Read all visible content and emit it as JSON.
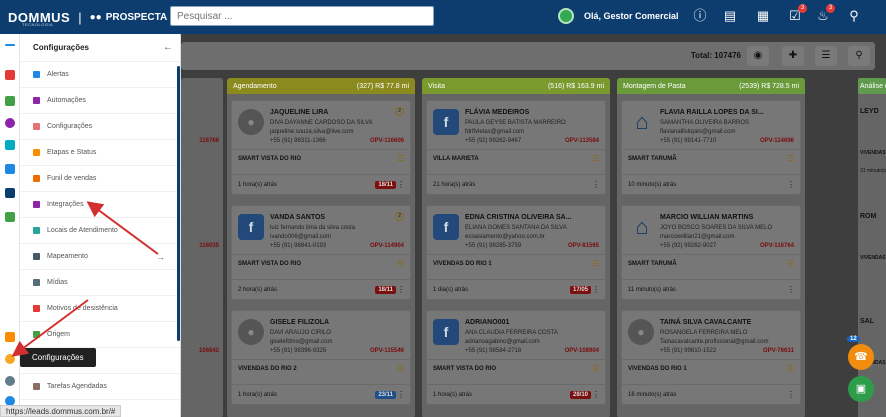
{
  "app": {
    "logo_main": "DOMMUS",
    "logo_sub": "TECNOLOGIA",
    "module": "PROSPECTA",
    "search_placeholder": "Pesquisar ...",
    "greeting": "Olá, Gestor Comercial",
    "badges": {
      "tasks": "3",
      "notifications": "3"
    }
  },
  "menu": {
    "title": "Configurações",
    "items": [
      {
        "label": "Alertas",
        "color": "#1e88e5"
      },
      {
        "label": "Automações",
        "color": "#8e24aa"
      },
      {
        "label": "Configurações",
        "color": "#e57373"
      },
      {
        "label": "Etapas e Status",
        "color": "#fb8c00"
      },
      {
        "label": "Funil de vendas",
        "color": "#ef6c00"
      },
      {
        "label": "Integrações",
        "color": "#8e24aa"
      },
      {
        "label": "Locais de Atendimento",
        "color": "#26a69a"
      },
      {
        "label": "Mapeamento",
        "color": "#455a64"
      },
      {
        "label": "Mídias",
        "color": "#546e7a"
      },
      {
        "label": "Motivos de desistência",
        "color": "#e53935"
      },
      {
        "label": "Origem",
        "color": "#43a047"
      },
      {
        "label": "Configurações",
        "color": "#43a047"
      },
      {
        "label": "Tarefas Agendadas",
        "color": "#8d6e63"
      }
    ]
  },
  "tooltip": "Configurações",
  "status_url": "https://leads.dommus.com.br/#",
  "toolbar": {
    "total": "Total: 107476"
  },
  "columns": [
    {
      "title": "Agendamento",
      "stats": "(327)  R$ 77.8 mi",
      "color": "#8a8a1e",
      "cards": [
        {
          "name": "JAQUELINE LIRA",
          "count": "2",
          "avatar": "photo",
          "l1": "DIVA DAYANNE CARDOSO DA SILVA",
          "l2": "jaqueline.souza.silva@live.com",
          "l3": "+55 (91) 98311-1366",
          "opv": "OPV-116606",
          "emp": "SMART VISTA DO RIO",
          "time": "1 hora(s) atrás",
          "date": "18/11",
          "date_style": "red"
        },
        {
          "name": "VANDA SANTOS",
          "count": "2",
          "avatar": "fb",
          "l1": "luiz fernando lima da silva costa",
          "l2": "ivando006@gmail.com",
          "l3": "+55 (91) 98841-0193",
          "opv": "OPV-114904",
          "emp": "SMART VISTA DO RIO",
          "time": "2 hora(s) atrás",
          "date": "18/11",
          "date_style": "red"
        },
        {
          "name": "GISELE FILIZOLA",
          "count": "",
          "avatar": "photo",
          "l1": "DAVI ARAUJO CIRILO",
          "l2": "giselefdmo@gmail.com",
          "l3": "+55 (91) 98396-9325",
          "opv": "OPV-115546",
          "emp": "VIVENDAS DO RIO 2",
          "time": "1 hora(s) atrás",
          "date": "23/11",
          "date_style": "blue"
        }
      ]
    },
    {
      "title": "Visita",
      "stats": "(516)  R$ 163.9 mi",
      "color": "#7a9a2e",
      "cards": [
        {
          "name": "FLÁVIA MEDEIROS",
          "count": "",
          "avatar": "fb",
          "l1": "PAULA GEYSE BATISTA MARREIRO",
          "l2": "fdrflvletas@gmail.com",
          "l3": "+55 (92) 99262-9467",
          "opv": "OPV-113584",
          "emp": "VILLA MARIETA",
          "time": "21 hora(s) atrás",
          "date": "",
          "date_style": ""
        },
        {
          "name": "EDNA CRISTINA OLIVEIRA SA...",
          "count": "",
          "avatar": "fb",
          "l1": "ELIANA GOMES SANTANA DA SILVA",
          "l2": "ecoasiamento@yahoo.com.br",
          "l3": "+55 (91) 98285-3759",
          "opv": "OPV-81565",
          "emp": "VIVENDAS DO RIO 1",
          "time": "1 dia(s) atrás",
          "date": "17/05",
          "date_style": "red"
        },
        {
          "name": "ADRIANO001",
          "count": "",
          "avatar": "fb",
          "l1": "ANA CLAUDIA FERREIRA COSTA",
          "l2": "adrianoagabino@gmail.com",
          "l3": "+55 (91) 98584-2718",
          "opv": "OPV-108904",
          "emp": "SMART VISTA DO RIO",
          "time": "1 hora(s) atrás",
          "date": "28/10",
          "date_style": "red"
        }
      ]
    },
    {
      "title": "Montagem de Pasta",
      "stats": "(2539)  R$ 728.5 mi",
      "color": "#6a9a3a",
      "cards": [
        {
          "name": "FLAVIA RAILLA LOPES DA SI...",
          "count": "",
          "avatar": "home",
          "l1": "SAMANTHA OLIVEIRA BARROS",
          "l2": "flavianalllslopes@gmail.com",
          "l3": "+55 (91) 99141-7710",
          "opv": "OPV-114696",
          "emp": "SMART TARUMÃ",
          "time": "10 minuto(s) atrás",
          "date": "",
          "date_style": ""
        },
        {
          "name": "MARCIO WILLIAN MARTINS",
          "count": "",
          "avatar": "home",
          "l1": "JOYO BOSCO SOARES DA SILVA MELO",
          "l2": "marciowillian21@gmail.com",
          "l3": "+55 (92) 99262-9027",
          "opv": "OPV-116764",
          "emp": "SMART TARUMÃ",
          "time": "11 minuto(s) atrás",
          "date": "",
          "date_style": ""
        },
        {
          "name": "TAINÁ SILVA CAVALCANTE",
          "count": "",
          "avatar": "photo",
          "l1": "ROSANGELA FERREIRA MELO",
          "l2": "Tainacavalcante.profissional@gmail.com",
          "l3": "+55 (91) 99610-1522",
          "opv": "OPV-76631",
          "emp": "VIVENDAS DO RIO 1",
          "time": "16 minuto(s) atrás",
          "date": "",
          "date_style": ""
        }
      ]
    }
  ],
  "partial_column": {
    "title": "Análise de Créd",
    "color": "#5f9a4f",
    "names": [
      "LEYD",
      "ROM",
      "SAL"
    ],
    "emps": [
      "VIVENDAS DO RIO",
      "VIVENDAS DO RIO",
      "VIVENDAS DO RIO"
    ],
    "times": [
      "31 minuto(s) atrás",
      "",
      ""
    ],
    "left_opvs": [
      "116766",
      "116035",
      "106642"
    ]
  },
  "fab": {
    "badge": "12"
  }
}
